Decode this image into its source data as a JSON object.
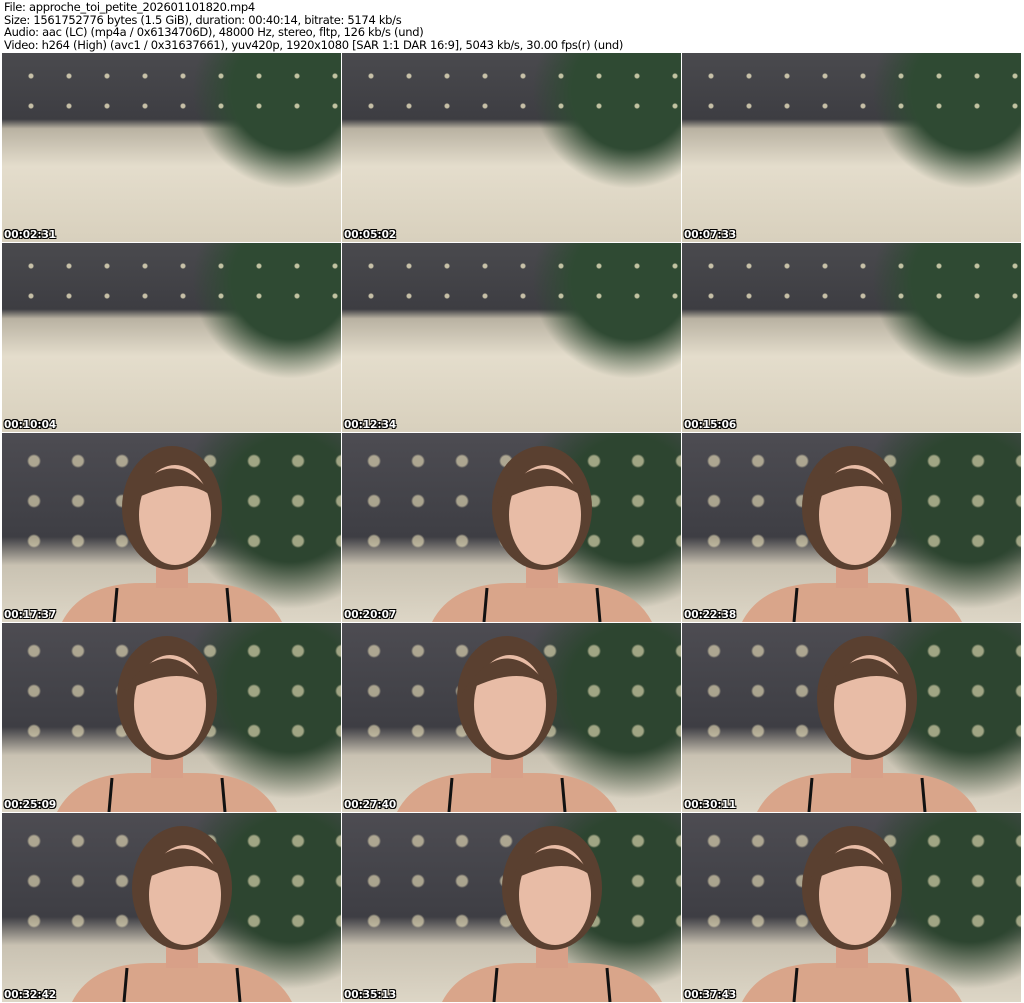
{
  "header": {
    "file": "File: approche_toi_petite_202601101820.mp4",
    "size": "Size: 1561752776 bytes (1.5 GiB), duration: 00:40:14, bitrate: 5174 kb/s",
    "audio": "Audio: aac (LC) (mp4a / 0x6134706D), 48000 Hz, stereo, fltp, 126 kb/s (und)",
    "video": "Video: h264 (High) (avc1 / 0x31637661), yuv420p, 1920x1080 [SAR 1:1 DAR 16:9], 5043 kb/s, 30.00 fps(r) (und)"
  },
  "thumbnails": [
    {
      "time": "00:02:31",
      "scene": "bed"
    },
    {
      "time": "00:05:02",
      "scene": "bed"
    },
    {
      "time": "00:07:33",
      "scene": "bed"
    },
    {
      "time": "00:10:04",
      "scene": "bed"
    },
    {
      "time": "00:12:34",
      "scene": "bed"
    },
    {
      "time": "00:15:06",
      "scene": "bed"
    },
    {
      "time": "00:17:37",
      "scene": "person"
    },
    {
      "time": "00:20:07",
      "scene": "person"
    },
    {
      "time": "00:22:38",
      "scene": "person"
    },
    {
      "time": "00:25:09",
      "scene": "person"
    },
    {
      "time": "00:27:40",
      "scene": "person"
    },
    {
      "time": "00:30:11",
      "scene": "person"
    },
    {
      "time": "00:32:42",
      "scene": "person"
    },
    {
      "time": "00:35:13",
      "scene": "person"
    },
    {
      "time": "00:37:43",
      "scene": "person"
    }
  ]
}
